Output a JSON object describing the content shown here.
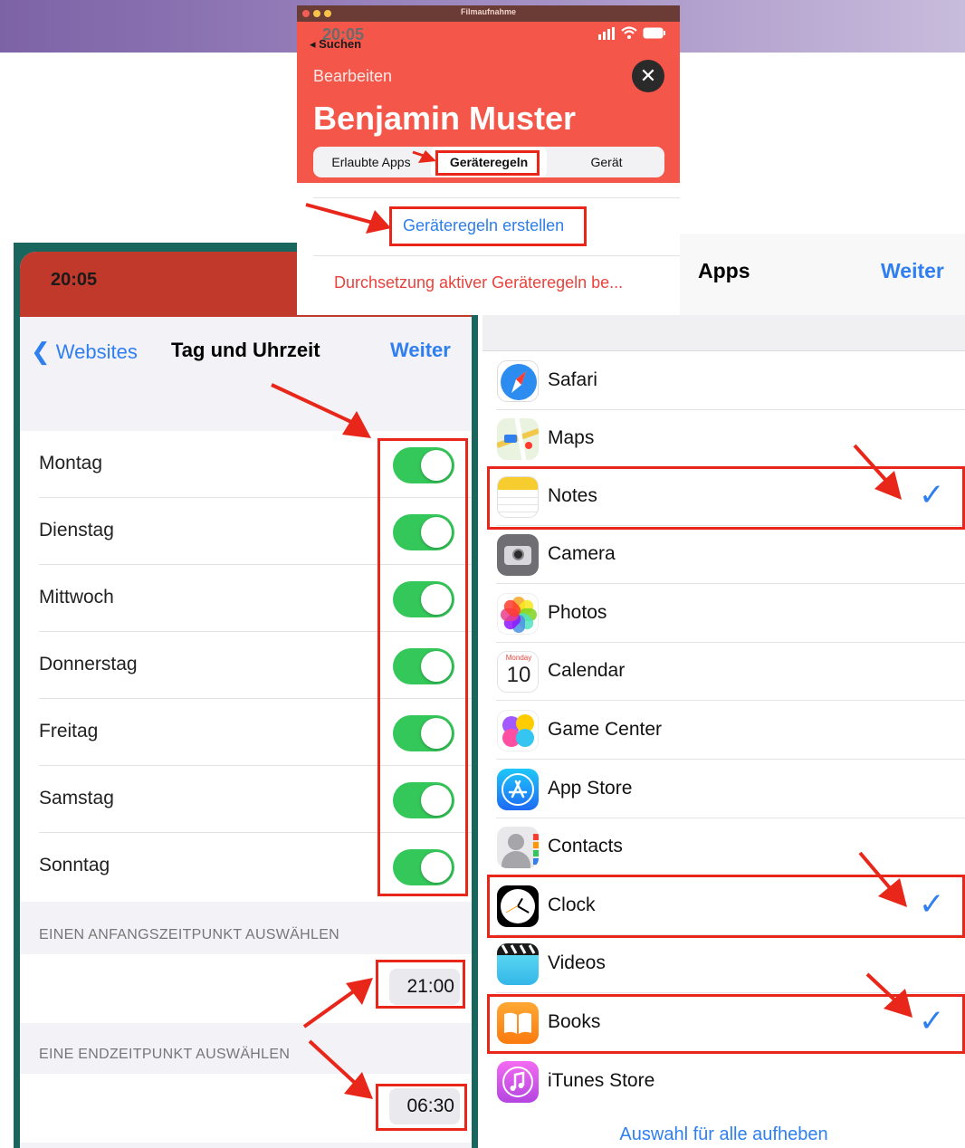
{
  "top": {
    "window_title": "Filmaufnahme",
    "status_time": "20:05",
    "back": "◂ Suchen",
    "edit": "Bearbeiten",
    "close_icon": "✕",
    "profile_name": "Benjamin Muster",
    "tabs": [
      "Erlaubte Apps",
      "Geräteregeln",
      "Gerät"
    ],
    "create_rules": "Geräteregeln erstellen",
    "enforce_rules": "Durchsetzung aktiver Geräteregeln be..."
  },
  "left": {
    "status_time": "20:05",
    "back": "Websites",
    "title": "Tag und Uhrzeit",
    "next": "Weiter",
    "days": [
      {
        "label": "Montag",
        "enabled": true
      },
      {
        "label": "Dienstag",
        "enabled": true
      },
      {
        "label": "Mittwoch",
        "enabled": true
      },
      {
        "label": "Donnerstag",
        "enabled": true
      },
      {
        "label": "Freitag",
        "enabled": true
      },
      {
        "label": "Samstag",
        "enabled": true
      },
      {
        "label": "Sonntag",
        "enabled": true
      }
    ],
    "start_header": "EINEN ANFANGSZEITPUNKT AUSWÄHLEN",
    "start_time": "21:00",
    "end_header": "EINE ENDZEITPUNKT AUSWÄHLEN",
    "end_time": "06:30"
  },
  "right": {
    "title": "Apps",
    "next": "Weiter",
    "apps": [
      {
        "label": "Safari",
        "icon": "safari-icon",
        "checked": false
      },
      {
        "label": "Maps",
        "icon": "maps-icon",
        "checked": false
      },
      {
        "label": "Notes",
        "icon": "notes-icon",
        "checked": true
      },
      {
        "label": "Camera",
        "icon": "camera-icon",
        "checked": false
      },
      {
        "label": "Photos",
        "icon": "photos-icon",
        "checked": false
      },
      {
        "label": "Calendar",
        "icon": "calendar-icon",
        "checked": false,
        "icon_month": "Monday",
        "icon_day": "10"
      },
      {
        "label": "Game Center",
        "icon": "game-center-icon",
        "checked": false
      },
      {
        "label": "App Store",
        "icon": "app-store-icon",
        "checked": false
      },
      {
        "label": "Contacts",
        "icon": "contacts-icon",
        "checked": false
      },
      {
        "label": "Clock",
        "icon": "clock-icon",
        "checked": true
      },
      {
        "label": "Videos",
        "icon": "videos-icon",
        "checked": false
      },
      {
        "label": "Books",
        "icon": "books-icon",
        "checked": true
      },
      {
        "label": "iTunes Store",
        "icon": "itunes-store-icon",
        "checked": false
      }
    ],
    "checkmark": "✓",
    "clear_all": "Auswahl für alle aufheben"
  },
  "colors": {
    "accent_blue": "#2f7ff0",
    "toggle_green": "#34c759",
    "highlight_red": "#e8271a",
    "profile_red": "#f5564a"
  }
}
